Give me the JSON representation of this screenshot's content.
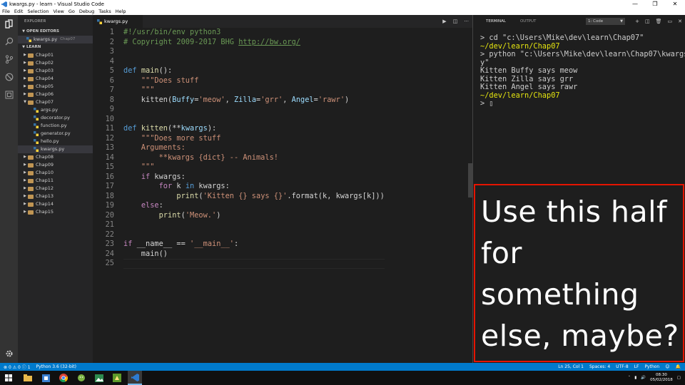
{
  "window": {
    "title": "kwargs.py - learn - Visual Studio Code",
    "min": "—",
    "max": "❐",
    "close": "✕"
  },
  "menu": [
    "File",
    "Edit",
    "Selection",
    "View",
    "Go",
    "Debug",
    "Tasks",
    "Help"
  ],
  "sidebar": {
    "header": "EXPLORER",
    "open_editors_label": "OPEN EDITORS",
    "open_file": "kwargs.py",
    "open_file_dir": "Chap07",
    "workspace_label": "LEARN",
    "folders": [
      "Chap01",
      "Chap02",
      "Chap03",
      "Chap04",
      "Chap05",
      "Chap06",
      "Chap07"
    ],
    "chap07_files": [
      "args.py",
      "decorator.py",
      "function.py",
      "generator.py",
      "hello.py",
      "kwargs.py"
    ],
    "folders_after": [
      "Chap08",
      "Chap09",
      "Chap10",
      "Chap11",
      "Chap12",
      "Chap13",
      "Chap14",
      "Chap15"
    ]
  },
  "editor": {
    "tab_label": "kwargs.py",
    "line_numbers": [
      "1",
      "2",
      "3",
      "4",
      "5",
      "6",
      "7",
      "8",
      "9",
      "10",
      "11",
      "12",
      "13",
      "14",
      "15",
      "16",
      "17",
      "18",
      "19",
      "20",
      "21",
      "22",
      "23",
      "24",
      "25"
    ],
    "lines": [
      [
        {
          "t": "#!/usr/bin/env python3",
          "c": "#6a9955"
        }
      ],
      [
        {
          "t": "# Copyright 2009-2017 BHG ",
          "c": "#6a9955"
        },
        {
          "t": "http://bw.org/",
          "c": "#6a9955",
          "u": true
        }
      ],
      [],
      [],
      [
        {
          "t": "def ",
          "c": "#569cd6"
        },
        {
          "t": "main",
          "c": "#dcdcaa"
        },
        {
          "t": "():",
          "c": "#d4d4d4"
        }
      ],
      [
        {
          "t": "    ",
          "c": "#d4d4d4"
        },
        {
          "t": "\"\"\"Does stuff",
          "c": "#ce9178"
        }
      ],
      [
        {
          "t": "    ",
          "c": "#d4d4d4"
        },
        {
          "t": "\"\"\"",
          "c": "#ce9178"
        }
      ],
      [
        {
          "t": "    kitten(",
          "c": "#d4d4d4"
        },
        {
          "t": "Buffy",
          "c": "#9cdcfe"
        },
        {
          "t": "=",
          "c": "#d4d4d4"
        },
        {
          "t": "'meow'",
          "c": "#ce9178"
        },
        {
          "t": ", ",
          "c": "#d4d4d4"
        },
        {
          "t": "Zilla",
          "c": "#9cdcfe"
        },
        {
          "t": "=",
          "c": "#d4d4d4"
        },
        {
          "t": "'grr'",
          "c": "#ce9178"
        },
        {
          "t": ", ",
          "c": "#d4d4d4"
        },
        {
          "t": "Angel",
          "c": "#9cdcfe"
        },
        {
          "t": "=",
          "c": "#d4d4d4"
        },
        {
          "t": "'rawr'",
          "c": "#ce9178"
        },
        {
          "t": ")",
          "c": "#d4d4d4"
        }
      ],
      [],
      [],
      [
        {
          "t": "def ",
          "c": "#569cd6"
        },
        {
          "t": "kitten",
          "c": "#dcdcaa"
        },
        {
          "t": "(**",
          "c": "#d4d4d4"
        },
        {
          "t": "kwargs",
          "c": "#9cdcfe"
        },
        {
          "t": "):",
          "c": "#d4d4d4"
        }
      ],
      [
        {
          "t": "    ",
          "c": "#d4d4d4"
        },
        {
          "t": "\"\"\"Does more stuff",
          "c": "#ce9178"
        }
      ],
      [
        {
          "t": "    Arguments:",
          "c": "#ce9178"
        }
      ],
      [
        {
          "t": "        **kwargs {dict} -- Animals!",
          "c": "#ce9178"
        }
      ],
      [
        {
          "t": "    ",
          "c": "#d4d4d4"
        },
        {
          "t": "\"\"\"",
          "c": "#ce9178"
        }
      ],
      [
        {
          "t": "    ",
          "c": "#d4d4d4"
        },
        {
          "t": "if",
          "c": "#c586c0"
        },
        {
          "t": " kwargs:",
          "c": "#d4d4d4"
        }
      ],
      [
        {
          "t": "        ",
          "c": "#d4d4d4"
        },
        {
          "t": "for",
          "c": "#c586c0"
        },
        {
          "t": " k ",
          "c": "#d4d4d4"
        },
        {
          "t": "in",
          "c": "#569cd6"
        },
        {
          "t": " kwargs:",
          "c": "#d4d4d4"
        }
      ],
      [
        {
          "t": "            ",
          "c": "#d4d4d4"
        },
        {
          "t": "print",
          "c": "#dcdcaa"
        },
        {
          "t": "(",
          "c": "#d4d4d4"
        },
        {
          "t": "'Kitten {} says {}'",
          "c": "#ce9178"
        },
        {
          "t": ".format(k, kwargs[k]))",
          "c": "#d4d4d4"
        }
      ],
      [
        {
          "t": "    ",
          "c": "#d4d4d4"
        },
        {
          "t": "else",
          "c": "#c586c0"
        },
        {
          "t": ":",
          "c": "#d4d4d4"
        }
      ],
      [
        {
          "t": "        ",
          "c": "#d4d4d4"
        },
        {
          "t": "print",
          "c": "#dcdcaa"
        },
        {
          "t": "(",
          "c": "#d4d4d4"
        },
        {
          "t": "'Meow.'",
          "c": "#ce9178"
        },
        {
          "t": ")",
          "c": "#d4d4d4"
        }
      ],
      [],
      [],
      [
        {
          "t": "if",
          "c": "#c586c0"
        },
        {
          "t": " __name__ ",
          "c": "#d4d4d4"
        },
        {
          "t": "==",
          "c": "#d4d4d4"
        },
        {
          "t": " ",
          "c": "#d4d4d4"
        },
        {
          "t": "'__main__'",
          "c": "#ce9178"
        },
        {
          "t": ":",
          "c": "#d4d4d4"
        }
      ],
      [
        {
          "t": "    main()",
          "c": "#d4d4d4"
        }
      ],
      []
    ]
  },
  "panel": {
    "tabs": [
      "TERMINAL",
      "OUTPUT"
    ],
    "active_tab": "TERMINAL",
    "terminal_select": "1: Code",
    "terminal_lines": [
      {
        "t": "> cd \"c:\\Users\\Mike\\dev\\learn\\Chap07\"",
        "c": "#cccccc"
      },
      {
        "t": "~/dev/learn/Chap07",
        "c": "#e5e510"
      },
      {
        "t": "> python \"c:\\Users\\Mike\\dev\\learn\\Chap07\\kwargs.p",
        "c": "#cccccc"
      },
      {
        "t": "y\"",
        "c": "#cccccc"
      },
      {
        "t": "Kitten Buffy says meow",
        "c": "#cccccc"
      },
      {
        "t": "Kitten Zilla says grr",
        "c": "#cccccc"
      },
      {
        "t": "Kitten Angel says rawr",
        "c": "#cccccc"
      },
      {
        "t": "~/dev/learn/Chap07",
        "c": "#e5e510"
      },
      {
        "t": "> ▯",
        "c": "#cccccc"
      }
    ]
  },
  "callout": {
    "text": "Use this half for something else, maybe?",
    "border_color": "#e51400"
  },
  "statusbar": {
    "errors": "0",
    "warnings": "0",
    "info": "1",
    "interpreter": "Python 3.6 (32-bit)",
    "position": "Ln 25, Col 1",
    "spaces": "Spaces: 4",
    "encoding": "UTF-8",
    "eol": "LF",
    "language": "Python",
    "bg": "#007acc"
  },
  "taskbar": {
    "time": "08:30",
    "date": "05/02/2018"
  }
}
